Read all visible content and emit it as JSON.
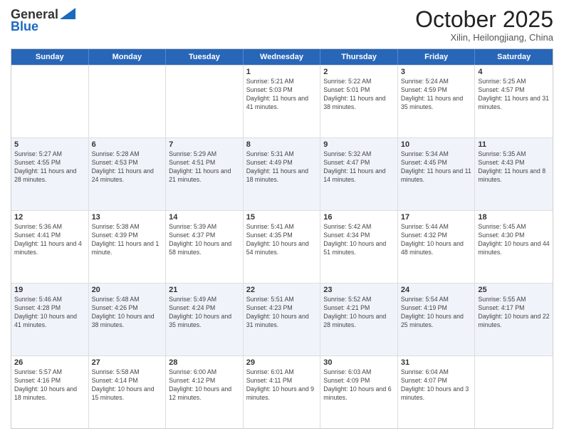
{
  "header": {
    "logo_general": "General",
    "logo_blue": "Blue",
    "month": "October 2025",
    "location": "Xilin, Heilongjiang, China"
  },
  "days_of_week": [
    "Sunday",
    "Monday",
    "Tuesday",
    "Wednesday",
    "Thursday",
    "Friday",
    "Saturday"
  ],
  "rows": [
    [
      {
        "day": "",
        "sunrise": "",
        "sunset": "",
        "daylight": ""
      },
      {
        "day": "",
        "sunrise": "",
        "sunset": "",
        "daylight": ""
      },
      {
        "day": "",
        "sunrise": "",
        "sunset": "",
        "daylight": ""
      },
      {
        "day": "1",
        "sunrise": "Sunrise: 5:21 AM",
        "sunset": "Sunset: 5:03 PM",
        "daylight": "Daylight: 11 hours and 41 minutes."
      },
      {
        "day": "2",
        "sunrise": "Sunrise: 5:22 AM",
        "sunset": "Sunset: 5:01 PM",
        "daylight": "Daylight: 11 hours and 38 minutes."
      },
      {
        "day": "3",
        "sunrise": "Sunrise: 5:24 AM",
        "sunset": "Sunset: 4:59 PM",
        "daylight": "Daylight: 11 hours and 35 minutes."
      },
      {
        "day": "4",
        "sunrise": "Sunrise: 5:25 AM",
        "sunset": "Sunset: 4:57 PM",
        "daylight": "Daylight: 11 hours and 31 minutes."
      }
    ],
    [
      {
        "day": "5",
        "sunrise": "Sunrise: 5:27 AM",
        "sunset": "Sunset: 4:55 PM",
        "daylight": "Daylight: 11 hours and 28 minutes."
      },
      {
        "day": "6",
        "sunrise": "Sunrise: 5:28 AM",
        "sunset": "Sunset: 4:53 PM",
        "daylight": "Daylight: 11 hours and 24 minutes."
      },
      {
        "day": "7",
        "sunrise": "Sunrise: 5:29 AM",
        "sunset": "Sunset: 4:51 PM",
        "daylight": "Daylight: 11 hours and 21 minutes."
      },
      {
        "day": "8",
        "sunrise": "Sunrise: 5:31 AM",
        "sunset": "Sunset: 4:49 PM",
        "daylight": "Daylight: 11 hours and 18 minutes."
      },
      {
        "day": "9",
        "sunrise": "Sunrise: 5:32 AM",
        "sunset": "Sunset: 4:47 PM",
        "daylight": "Daylight: 11 hours and 14 minutes."
      },
      {
        "day": "10",
        "sunrise": "Sunrise: 5:34 AM",
        "sunset": "Sunset: 4:45 PM",
        "daylight": "Daylight: 11 hours and 11 minutes."
      },
      {
        "day": "11",
        "sunrise": "Sunrise: 5:35 AM",
        "sunset": "Sunset: 4:43 PM",
        "daylight": "Daylight: 11 hours and 8 minutes."
      }
    ],
    [
      {
        "day": "12",
        "sunrise": "Sunrise: 5:36 AM",
        "sunset": "Sunset: 4:41 PM",
        "daylight": "Daylight: 11 hours and 4 minutes."
      },
      {
        "day": "13",
        "sunrise": "Sunrise: 5:38 AM",
        "sunset": "Sunset: 4:39 PM",
        "daylight": "Daylight: 11 hours and 1 minute."
      },
      {
        "day": "14",
        "sunrise": "Sunrise: 5:39 AM",
        "sunset": "Sunset: 4:37 PM",
        "daylight": "Daylight: 10 hours and 58 minutes."
      },
      {
        "day": "15",
        "sunrise": "Sunrise: 5:41 AM",
        "sunset": "Sunset: 4:35 PM",
        "daylight": "Daylight: 10 hours and 54 minutes."
      },
      {
        "day": "16",
        "sunrise": "Sunrise: 5:42 AM",
        "sunset": "Sunset: 4:34 PM",
        "daylight": "Daylight: 10 hours and 51 minutes."
      },
      {
        "day": "17",
        "sunrise": "Sunrise: 5:44 AM",
        "sunset": "Sunset: 4:32 PM",
        "daylight": "Daylight: 10 hours and 48 minutes."
      },
      {
        "day": "18",
        "sunrise": "Sunrise: 5:45 AM",
        "sunset": "Sunset: 4:30 PM",
        "daylight": "Daylight: 10 hours and 44 minutes."
      }
    ],
    [
      {
        "day": "19",
        "sunrise": "Sunrise: 5:46 AM",
        "sunset": "Sunset: 4:28 PM",
        "daylight": "Daylight: 10 hours and 41 minutes."
      },
      {
        "day": "20",
        "sunrise": "Sunrise: 5:48 AM",
        "sunset": "Sunset: 4:26 PM",
        "daylight": "Daylight: 10 hours and 38 minutes."
      },
      {
        "day": "21",
        "sunrise": "Sunrise: 5:49 AM",
        "sunset": "Sunset: 4:24 PM",
        "daylight": "Daylight: 10 hours and 35 minutes."
      },
      {
        "day": "22",
        "sunrise": "Sunrise: 5:51 AM",
        "sunset": "Sunset: 4:23 PM",
        "daylight": "Daylight: 10 hours and 31 minutes."
      },
      {
        "day": "23",
        "sunrise": "Sunrise: 5:52 AM",
        "sunset": "Sunset: 4:21 PM",
        "daylight": "Daylight: 10 hours and 28 minutes."
      },
      {
        "day": "24",
        "sunrise": "Sunrise: 5:54 AM",
        "sunset": "Sunset: 4:19 PM",
        "daylight": "Daylight: 10 hours and 25 minutes."
      },
      {
        "day": "25",
        "sunrise": "Sunrise: 5:55 AM",
        "sunset": "Sunset: 4:17 PM",
        "daylight": "Daylight: 10 hours and 22 minutes."
      }
    ],
    [
      {
        "day": "26",
        "sunrise": "Sunrise: 5:57 AM",
        "sunset": "Sunset: 4:16 PM",
        "daylight": "Daylight: 10 hours and 18 minutes."
      },
      {
        "day": "27",
        "sunrise": "Sunrise: 5:58 AM",
        "sunset": "Sunset: 4:14 PM",
        "daylight": "Daylight: 10 hours and 15 minutes."
      },
      {
        "day": "28",
        "sunrise": "Sunrise: 6:00 AM",
        "sunset": "Sunset: 4:12 PM",
        "daylight": "Daylight: 10 hours and 12 minutes."
      },
      {
        "day": "29",
        "sunrise": "Sunrise: 6:01 AM",
        "sunset": "Sunset: 4:11 PM",
        "daylight": "Daylight: 10 hours and 9 minutes."
      },
      {
        "day": "30",
        "sunrise": "Sunrise: 6:03 AM",
        "sunset": "Sunset: 4:09 PM",
        "daylight": "Daylight: 10 hours and 6 minutes."
      },
      {
        "day": "31",
        "sunrise": "Sunrise: 6:04 AM",
        "sunset": "Sunset: 4:07 PM",
        "daylight": "Daylight: 10 hours and 3 minutes."
      },
      {
        "day": "",
        "sunrise": "",
        "sunset": "",
        "daylight": ""
      }
    ]
  ]
}
